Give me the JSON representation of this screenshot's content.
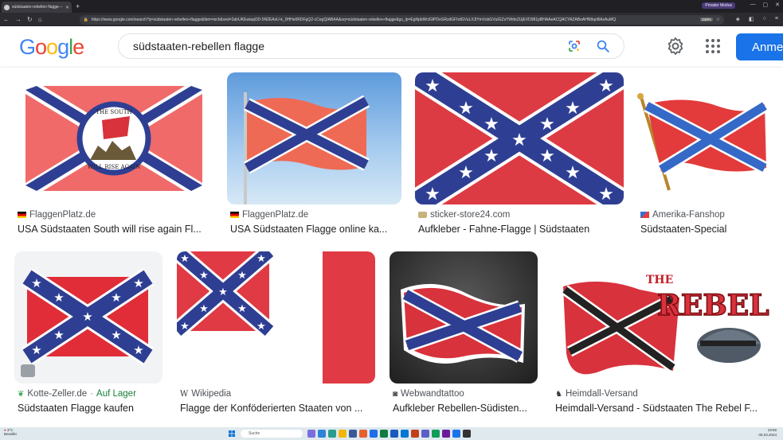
{
  "browser": {
    "tab_title": "südstaaten-rebellen flagge – Go...",
    "private_label": "Privater Modus",
    "url": "https://www.google.com/search?q=südstaaten-rebellen+flagge&tbm=isch&ved=2ahUKEwiaqOD-5N2EAxU-k_0HHe0RDFgQ2-cCegQIABAA&oq=südstaaten-rebellen+flagge&gs_lp=EgNpbWciGlPDvGRzdGFhdGVuLXJlYmVsbGVuIGZsYWdnZUjEVD981pBHAAeACQACYAZABoAHN8qoBAzAuMQ",
    "zoom": "240%"
  },
  "header": {
    "logo": [
      "G",
      "o",
      "o",
      "g",
      "l",
      "e"
    ],
    "search_query": "südstaaten-rebellen flagge",
    "signin_label": "Anme"
  },
  "results": [
    {
      "source": "FlaggenPlatz.de",
      "caption": "USA Südstaaten South will rise again Fl...",
      "flag": "de",
      "badge": "THE SOUTH WILL RISE AGAIN"
    },
    {
      "source": "FlaggenPlatz.de",
      "caption": "USA Südstaaten Flagge online ka...",
      "flag": "de"
    },
    {
      "source": "sticker-store24.com",
      "caption": "Aufkleber - Fahne-Flagge | Südstaaten",
      "flag": "generic"
    },
    {
      "source": "Amerika-Fanshop",
      "caption": "Südstaaten-Special",
      "flag": "us"
    },
    {
      "source": "Kotte-Zeller.de",
      "stock": "Auf Lager",
      "caption": "Südstaaten Flagge kaufen",
      "flag": "leaf"
    },
    {
      "source": "Wikipedia",
      "caption": "Flagge der Konföderierten Staaten von ...",
      "flag": "w"
    },
    {
      "source": "Webwandtattoo",
      "caption": "Aufkleber Rebellen-Südisten...",
      "flag": "cam"
    },
    {
      "source": "Heimdall-Versand",
      "caption": "Heimdall-Versand - Südstaaten The Rebel F...",
      "flag": "helmet",
      "badge": "THE REBEL"
    }
  ],
  "taskbar": {
    "weather_temp": "3°C",
    "weather_desc": "Bewölkt",
    "search_placeholder": "Suche",
    "time": "19:59",
    "date": "05.03.2024"
  },
  "colors": {
    "flag_red": "#d8323c",
    "flag_blue": "#2e3f93",
    "google_blue": "#1a73e8"
  }
}
